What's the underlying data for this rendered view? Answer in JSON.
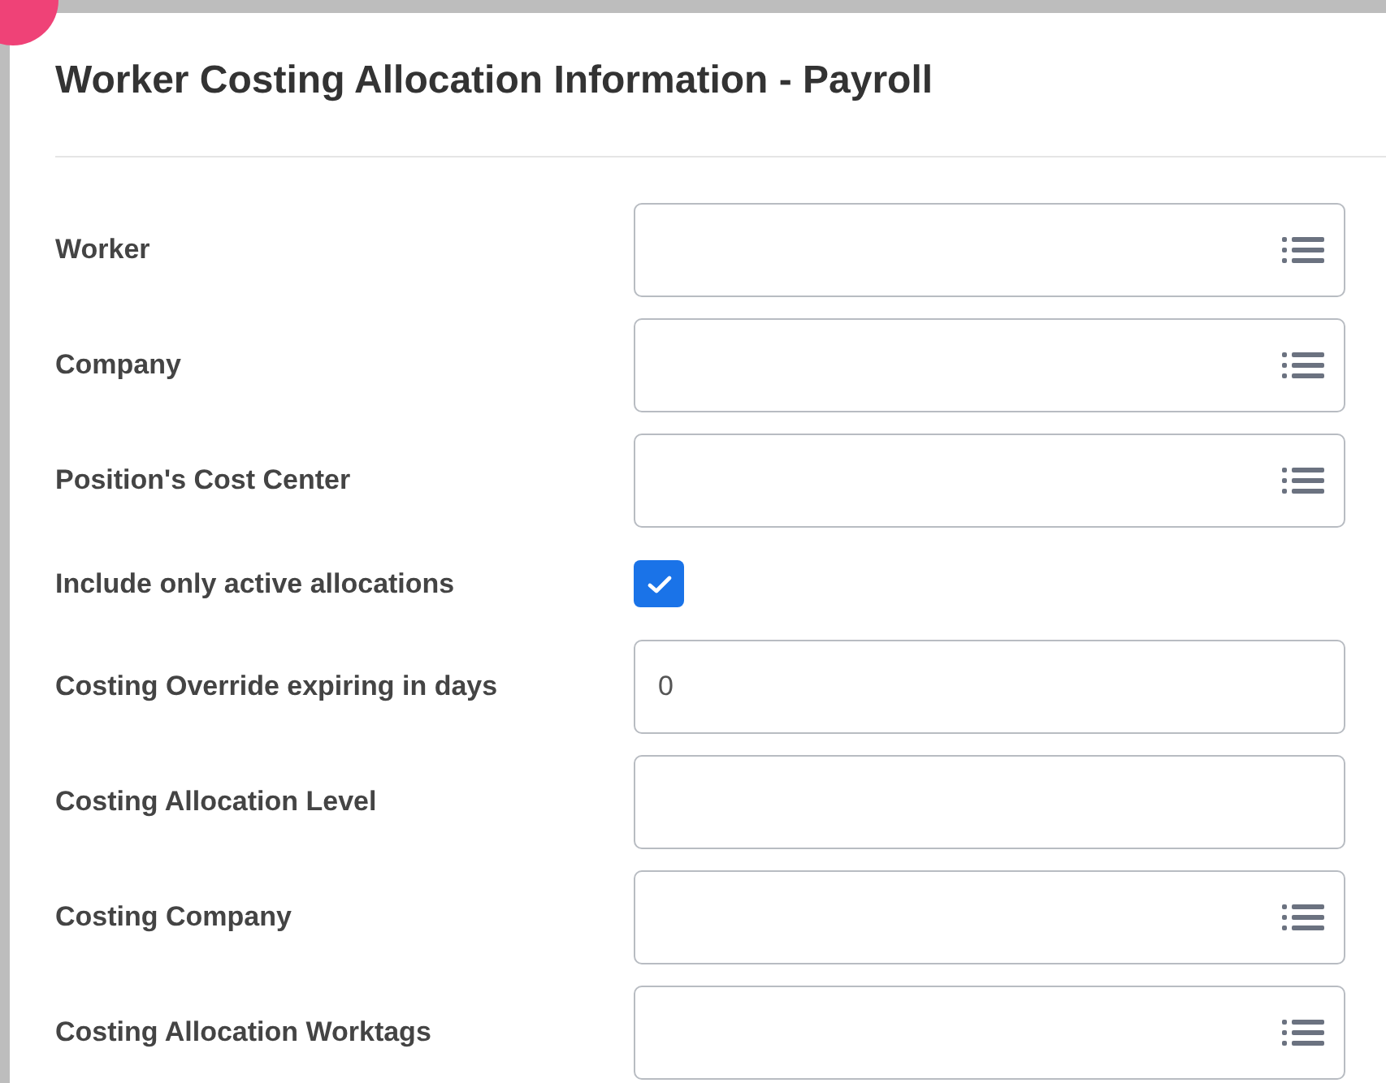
{
  "title": "Worker Costing Allocation Information - Payroll",
  "fields": [
    {
      "kind": "prompt",
      "label": "Worker"
    },
    {
      "kind": "prompt",
      "label": "Company"
    },
    {
      "kind": "prompt",
      "label": "Position's Cost Center"
    },
    {
      "kind": "checkbox",
      "label": "Include only active allocations",
      "checked": true
    },
    {
      "kind": "text",
      "label": "Costing Override expiring in days",
      "value": "0"
    },
    {
      "kind": "text",
      "label": "Costing Allocation Level"
    },
    {
      "kind": "prompt",
      "label": "Costing Company"
    },
    {
      "kind": "prompt",
      "label": "Costing Allocation Worktags"
    }
  ]
}
